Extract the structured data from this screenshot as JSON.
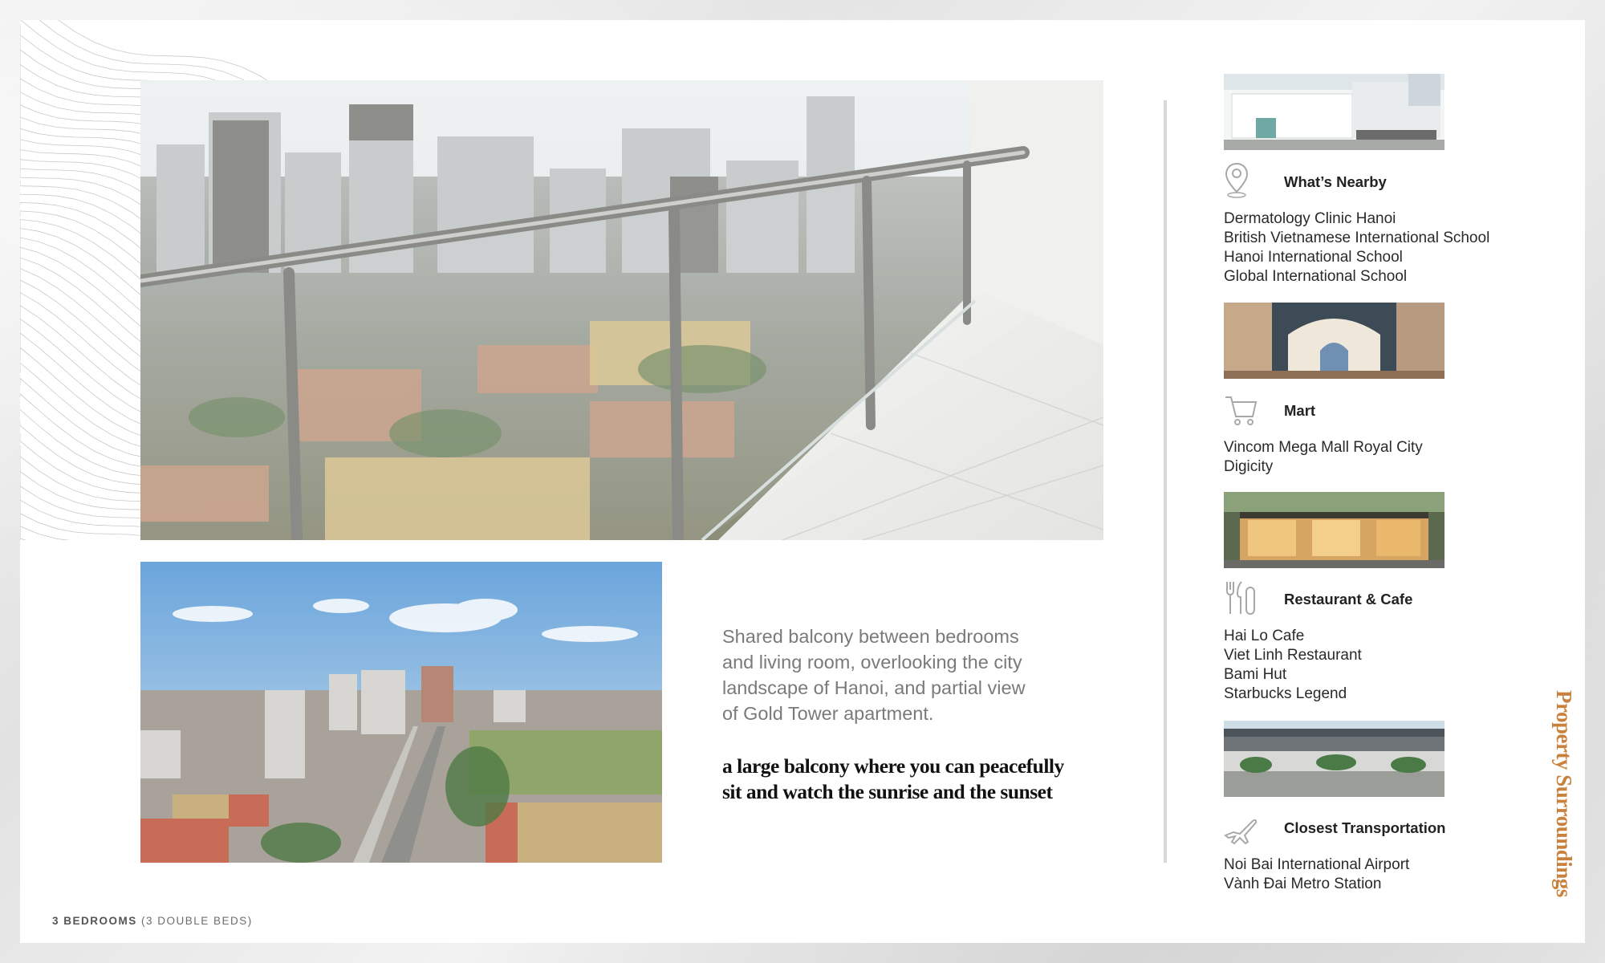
{
  "main": {
    "caption": "Shared balcony between bedrooms\nand living room, overlooking the city\nlandscape of Hanoi, and partial view\nof Gold Tower apartment.",
    "tagline": "a large balcony where you can peacefully\nsit and watch the sunrise and the sunset"
  },
  "footer": {
    "bedrooms": "3 BEDROOMS",
    "beds": " (3 DOUBLE BEDS)"
  },
  "sidebar": {
    "vertical_title": "Property Surroundings",
    "sections": [
      {
        "title": "What’s Nearby",
        "icon": "location-pin-icon",
        "items": [
          "Dermatology Clinic Hanoi",
          "British Vietnamese International School",
          "Hanoi International School",
          "Global International School"
        ]
      },
      {
        "title": "Mart",
        "icon": "shopping-cart-icon",
        "items": [
          "Vincom Mega Mall Royal City",
          "Digicity"
        ]
      },
      {
        "title": "Restaurant & Cafe",
        "icon": "utensils-icon",
        "items": [
          "Hai Lo Cafe",
          "Viet Linh Restaurant",
          "Bami Hut",
          "Starbucks Legend"
        ]
      },
      {
        "title": "Closest Transportation",
        "icon": "airplane-icon",
        "items": [
          "Noi Bai International Airport",
          "Vành Đai Metro Station"
        ]
      }
    ]
  },
  "colors": {
    "accent": "#c9823e",
    "divider": "#d9d9d9",
    "caption_text": "#7a7a7a"
  }
}
